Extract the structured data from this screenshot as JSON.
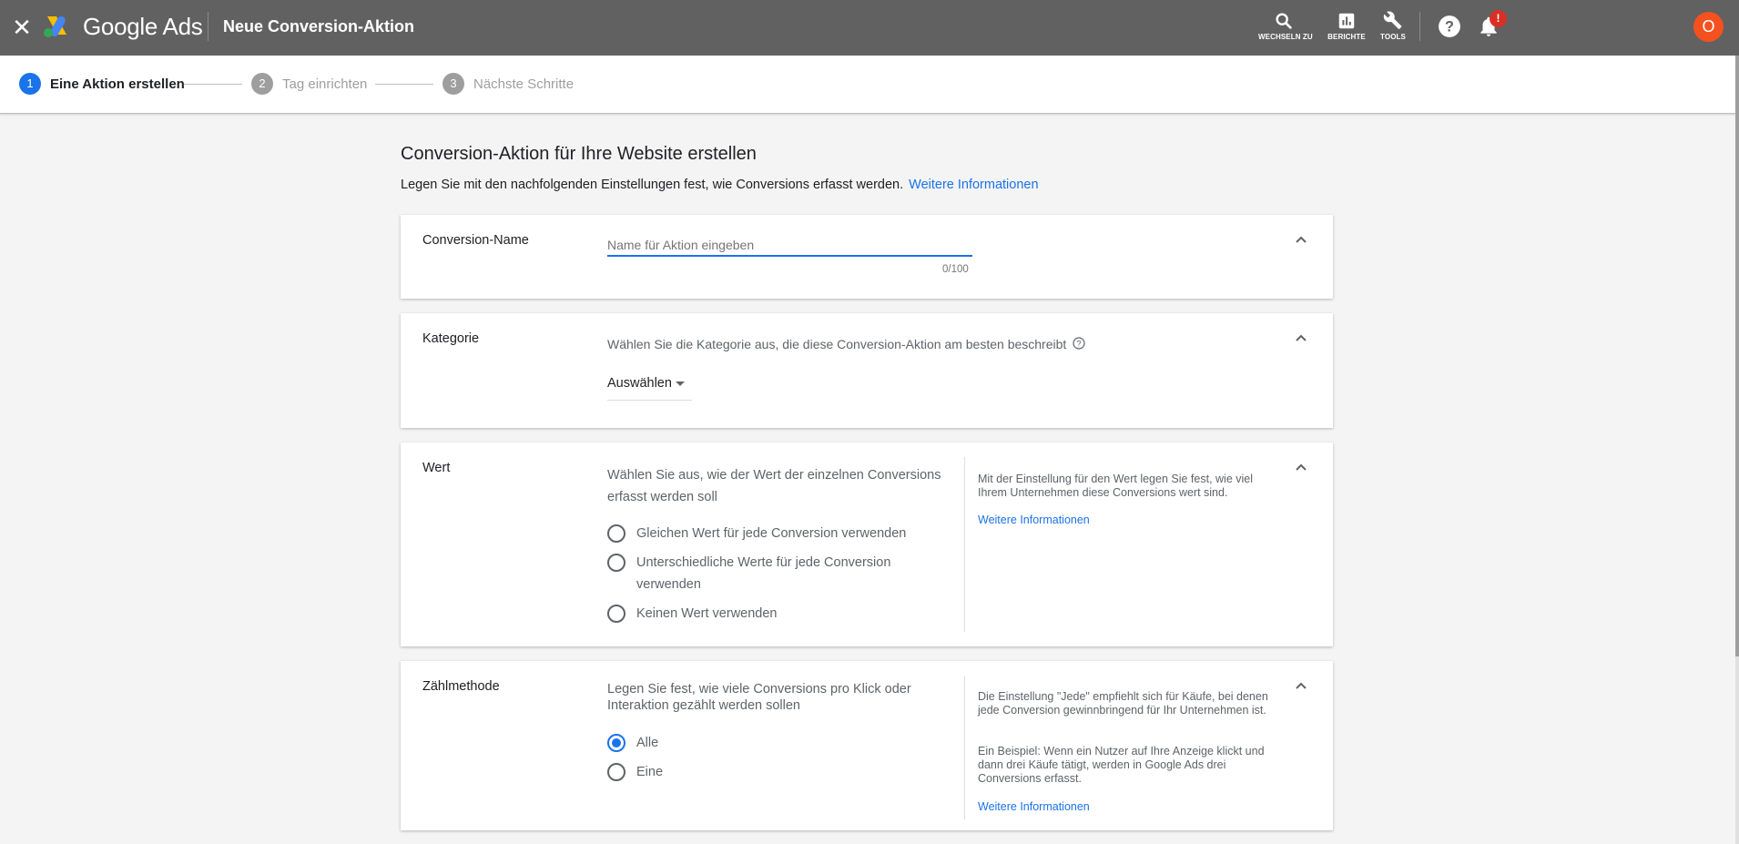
{
  "topbar": {
    "close_icon": "close-icon",
    "brand": "Google Ads",
    "title": "Neue Conversion-Aktion",
    "actions": [
      {
        "icon": "search-icon",
        "label": "WECHSELN ZU"
      },
      {
        "icon": "bar-chart-icon",
        "label": "BERICHTE"
      },
      {
        "icon": "wrench-icon",
        "label": "TOOLS"
      }
    ],
    "help_icon": "help-icon",
    "bell_icon": "bell-icon",
    "notification_badge": "!",
    "avatar_initial": "O",
    "colors": {
      "bar": "#616161",
      "badge": "#d93025",
      "avatar": "#f4511e"
    }
  },
  "stepper": {
    "steps": [
      {
        "num": "1",
        "label": "Eine Aktion erstellen",
        "active": true
      },
      {
        "num": "2",
        "label": "Tag einrichten",
        "active": false
      },
      {
        "num": "3",
        "label": "Nächste Schritte",
        "active": false
      }
    ],
    "accent": "#1a73e8"
  },
  "main": {
    "title": "Conversion-Aktion für Ihre Website erstellen",
    "subtitle": "Legen Sie mit den nachfolgenden Einstellungen fest, wie Conversions erfasst werden.",
    "subtitle_link": "Weitere Informationen"
  },
  "name_card": {
    "label": "Conversion-Name",
    "placeholder": "Name für Aktion eingeben",
    "value": "",
    "counter": "0/100"
  },
  "category_card": {
    "label": "Kategorie",
    "description": "Wählen Sie die Kategorie aus, die diese Conversion-Aktion am besten beschreibt",
    "info_icon": "help-circle-icon",
    "select_value": "Auswählen"
  },
  "value_card": {
    "label": "Wert",
    "description": "Wählen Sie aus, wie der Wert der einzelnen Conversions erfasst werden soll",
    "options": [
      {
        "label": "Gleichen Wert für jede Conversion verwenden",
        "checked": false
      },
      {
        "label": "Unterschiedliche Werte für jede Conversion verwenden",
        "checked": false
      },
      {
        "label": "Keinen Wert verwenden",
        "checked": false
      }
    ],
    "help_text": "Mit der Einstellung für den Wert legen Sie fest, wie viel Ihrem Unternehmen diese Conversions wert sind.",
    "help_link": "Weitere Informationen"
  },
  "count_card": {
    "label": "Zählmethode",
    "description": "Legen Sie fest, wie viele Conversions pro Klick oder Interaktion gezählt werden sollen",
    "options": [
      {
        "label": "Alle",
        "checked": true
      },
      {
        "label": "Eine",
        "checked": false
      }
    ],
    "help_text_1": "Die Einstellung \"Jede\" empfiehlt sich für Käufe, bei denen jede Conversion gewinnbringend für Ihr Unternehmen ist.",
    "help_text_2": "Ein Beispiel: Wenn ein Nutzer auf Ihre Anzeige klickt und dann drei Käufe tätigt, werden in Google Ads drei Conversions erfasst.",
    "help_link": "Weitere Informationen"
  }
}
